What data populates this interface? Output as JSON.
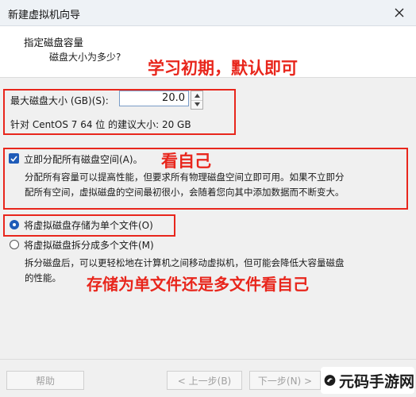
{
  "window": {
    "title": "新建虚拟机向导"
  },
  "header": {
    "title": "指定磁盘容量",
    "subtitle": "磁盘大小为多少?"
  },
  "annotations": {
    "note1": "学习初期，默认即可",
    "note2": "看自己",
    "note3": "存储为单文件还是多文件看自己"
  },
  "disk": {
    "size_label": "最大磁盘大小 (GB)(S):",
    "size_value": "20.0",
    "recommendation": "针对 CentOS 7 64 位 的建议大小: 20 GB"
  },
  "allocate": {
    "label": "立即分配所有磁盘空间(A)。",
    "checked": true,
    "description_line1": "分配所有容量可以提高性能，但要求所有物理磁盘空间立即可用。如果不立即分",
    "description_line2": "配所有空间，虚拟磁盘的空间最初很小，会随着您向其中添加数据而不断变大。"
  },
  "storage": {
    "single_label": "将虚拟磁盘存储为单个文件(O)",
    "multi_label": "将虚拟磁盘拆分成多个文件(M)",
    "selected": "single",
    "description_line1": "拆分磁盘后，可以更轻松地在计算机之间移动虚拟机，但可能会降低大容量磁盘",
    "description_line2": "的性能。"
  },
  "buttons": {
    "help": "帮助",
    "back": "< 上一步(B)",
    "next": "下一步(N) >"
  },
  "watermark": {
    "text": "元码手游网"
  },
  "colors": {
    "accent": "#1e5bb8",
    "annotation": "#e8261c",
    "background": "#f0f0f0",
    "header_bg": "#ffffff"
  }
}
